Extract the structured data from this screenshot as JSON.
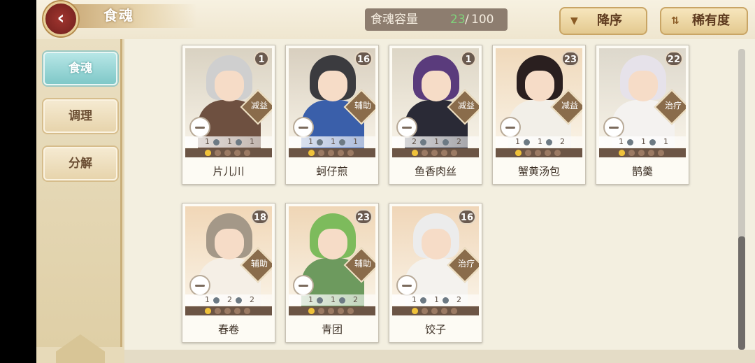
{
  "header": {
    "title": "食魂",
    "back_icon": "chevron-left-icon",
    "capacity_label": "食魂容量",
    "capacity_current": "23",
    "capacity_separator": "/",
    "capacity_max": "100",
    "sort_order_label": "降序",
    "sort_order_icon": "triangle-down-icon",
    "sort_key_label": "稀有度",
    "sort_key_icon": "sort-arrows-icon"
  },
  "sidebar": {
    "items": [
      {
        "label": "食魂",
        "active": true
      },
      {
        "label": "调理",
        "active": false
      },
      {
        "label": "分解",
        "active": false
      }
    ]
  },
  "colors": {
    "accent_teal": "#8fd0cf",
    "capacity_green": "#7fd37a",
    "card_border": "#c8c2b4"
  },
  "cards": [
    {
      "name": "片儿川",
      "level": "1",
      "role": "减益",
      "stats": [
        "1",
        "1",
        "1"
      ],
      "hair": "#cfcfcf",
      "outfit": "#6e5040",
      "bg": "#d9d2c2"
    },
    {
      "name": "蚵仔煎",
      "level": "16",
      "role": "辅助",
      "stats": [
        "1",
        "1",
        "1"
      ],
      "hair": "#3b3b3f",
      "outfit": "#3a5faa",
      "bg": "#d8cfbf"
    },
    {
      "name": "鱼香肉丝",
      "level": "1",
      "role": "减益",
      "stats": [
        "2",
        "1",
        "2"
      ],
      "hair": "#5a3b7c",
      "outfit": "#2a2a36",
      "bg": "#ddd6c6"
    },
    {
      "name": "蟹黄汤包",
      "level": "23",
      "role": "减益",
      "stats": [
        "1",
        "1",
        "2"
      ],
      "hair": "#2a1f1f",
      "outfit": "#f2efe8",
      "bg": "#f0d9bb"
    },
    {
      "name": "鹊羹",
      "level": "22",
      "role": "治疗",
      "stats": [
        "1",
        "1",
        "1"
      ],
      "hair": "#e6e2ea",
      "outfit": "#f4f2f0",
      "bg": "#ddd8cc"
    },
    {
      "name": "春卷",
      "level": "18",
      "role": "辅助",
      "stats": [
        "1",
        "2",
        "2"
      ],
      "hair": "#a49888",
      "outfit": "#f5efe6",
      "bg": "#f1d7b7"
    },
    {
      "name": "青团",
      "level": "23",
      "role": "辅助",
      "stats": [
        "1",
        "1",
        "2"
      ],
      "hair": "#7dbb5c",
      "outfit": "#6d9a5e",
      "bg": "#efd6b6"
    },
    {
      "name": "饺子",
      "level": "16",
      "role": "治疗",
      "stats": [
        "1",
        "1",
        "2"
      ],
      "hair": "#ececec",
      "outfit": "#f4f2ee",
      "bg": "#f0d6b8"
    }
  ]
}
